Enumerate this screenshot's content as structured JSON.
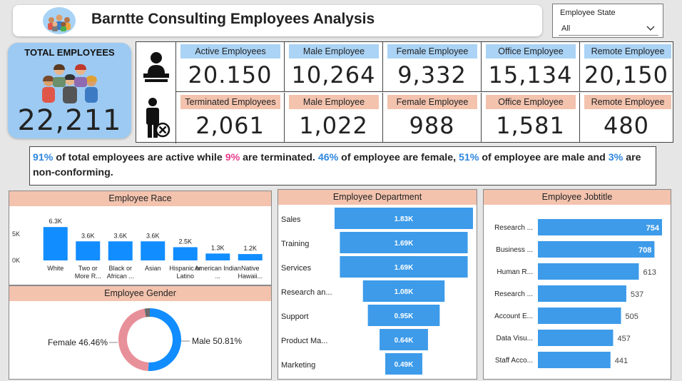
{
  "header": {
    "title": "Barntte Consulting Employees Analysis"
  },
  "filter": {
    "label": "Employee State",
    "value": "All"
  },
  "total": {
    "label": "TOTAL EMPLOYEES",
    "value": "22,211"
  },
  "kpis": {
    "top": [
      {
        "label": "Active Employees",
        "value": "20.150"
      },
      {
        "label": "Male Employee",
        "value": "10,264"
      },
      {
        "label": "Female Employee",
        "value": "9,332"
      },
      {
        "label": "Office Employee",
        "value": "15,134"
      },
      {
        "label": "Remote Employee",
        "value": "20,150"
      }
    ],
    "bottom": [
      {
        "label": "Terminated Employees",
        "value": "2,061"
      },
      {
        "label": "Male Employee",
        "value": "1,022"
      },
      {
        "label": "Female Employee",
        "value": "988"
      },
      {
        "label": "Office Employee",
        "value": "1,581"
      },
      {
        "label": "Remote Employee",
        "value": "480"
      }
    ]
  },
  "summary": {
    "active_pct": "91%",
    "t1": " of total employees are active while ",
    "term_pct": "9%",
    "t2": " are terminated. ",
    "female_pct": "46%",
    "t3": " of employee are female, ",
    "male_pct": "51%",
    "t4": " of employee are male and ",
    "nc_pct": "3%",
    "t5": " are non-conforming."
  },
  "colors": {
    "bar": "#3d9be9",
    "bar_light": "#5aaaf0",
    "male": "#118dff",
    "female": "#e8909a",
    "other": "#6b6b6b",
    "header": "#f3c3ae"
  },
  "chart_data": [
    {
      "type": "bar",
      "title": "Employee Race",
      "categories": [
        "White",
        "Two or More R...",
        "Black or African ...",
        "Asian",
        "Hispanic or Latino",
        "American Indian ...",
        "Native Hawaii..."
      ],
      "values": [
        6300,
        3600,
        3600,
        3600,
        2500,
        1300,
        1200
      ],
      "data_labels": [
        "6.3K",
        "3.6K",
        "3.6K",
        "3.6K",
        "2.5K",
        "1.3K",
        "1.2K"
      ],
      "yticks": [
        "0K",
        "5K"
      ],
      "ylim": [
        0,
        7000
      ]
    },
    {
      "type": "pie",
      "title": "Employee Gender",
      "categories": [
        "Female",
        "Male",
        "Non-Conforming"
      ],
      "values": [
        46.46,
        50.81,
        2.73
      ],
      "labels": [
        "Female 46.46%",
        "Male 50.81%"
      ]
    },
    {
      "type": "bar",
      "title": "Employee Department",
      "orientation": "funnel",
      "categories": [
        "Sales",
        "Training",
        "Services",
        "Research an...",
        "Support",
        "Product Ma...",
        "Marketing"
      ],
      "values": [
        1830,
        1690,
        1690,
        1080,
        950,
        640,
        490
      ],
      "data_labels": [
        "1.83K",
        "1.69K",
        "1.69K",
        "1.08K",
        "0.95K",
        "0.64K",
        "0.49K"
      ]
    },
    {
      "type": "bar",
      "title": "Employee Jobtitle",
      "orientation": "horizontal",
      "categories": [
        "Research ...",
        "Business ...",
        "Human R...",
        "Research ...",
        "Account E...",
        "Data Visu...",
        "Staff Acco..."
      ],
      "values": [
        754,
        708,
        613,
        537,
        505,
        457,
        441
      ],
      "data_labels": [
        "754",
        "708",
        "613",
        "537",
        "505",
        "457",
        "441"
      ]
    }
  ]
}
